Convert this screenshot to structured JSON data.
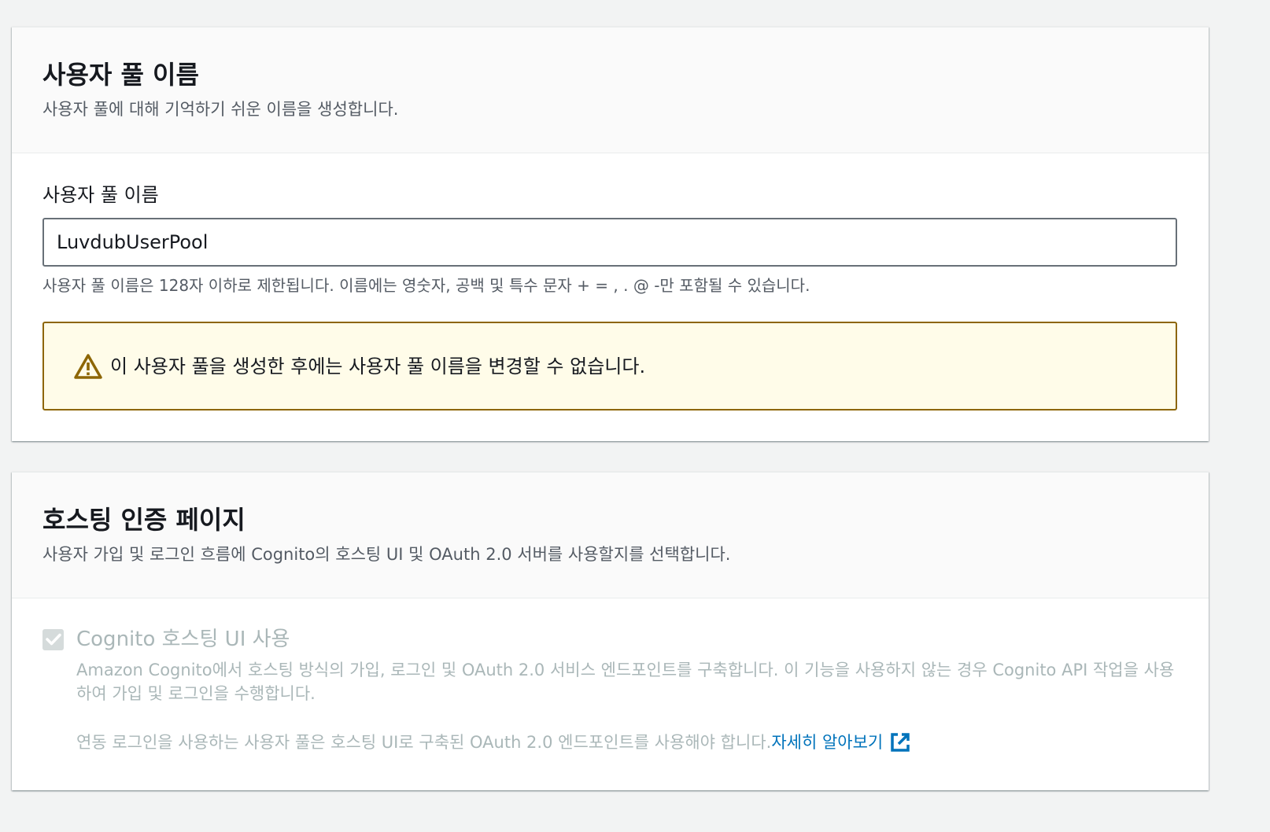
{
  "user_pool_name_section": {
    "title": "사용자 풀 이름",
    "description": "사용자 풀에 대해 기억하기 쉬운 이름을 생성합니다.",
    "field_label": "사용자 풀 이름",
    "field_value": "LuvdubUserPool",
    "field_hint": "사용자 풀 이름은 128자 이하로 제한됩니다. 이름에는 영숫자, 공백 및 특수 문자 + = , . @ -만 포함될 수 있습니다.",
    "warning_text": "이 사용자 풀을 생성한 후에는 사용자 풀 이름을 변경할 수 없습니다.",
    "warning_icon": "warning-triangle-icon"
  },
  "hosted_auth_section": {
    "title": "호스팅 인증 페이지",
    "description": "사용자 가입 및 로그인 흐름에 Cognito의 호스팅 UI 및 OAuth 2.0 서버를 사용할지를 선택합니다.",
    "checkbox_label": "Cognito 호스팅 UI 사용",
    "checkbox_checked": true,
    "checkbox_disabled": true,
    "checkbox_description": "Amazon Cognito에서 호스팅 방식의 가입, 로그인 및 OAuth 2.0 서비스 엔드포인트를 구축합니다. 이 기능을 사용하지 않는 경우 Cognito API 작업을 사용하여 가입 및 로그인을 수행합니다.",
    "federation_text": "연동 로그인을 사용하는 사용자 풀은 호스팅 UI로 구축된 OAuth 2.0 엔드포인트를 사용해야 합니다.",
    "learn_more_label": "자세히 알아보기",
    "learn_more_icon": "external-link-icon"
  },
  "colors": {
    "background": "#f2f3f3",
    "warning_border": "#8d6605",
    "warning_background": "#fffce9",
    "link": "#0073bb",
    "disabled_text": "#aab7b8"
  }
}
